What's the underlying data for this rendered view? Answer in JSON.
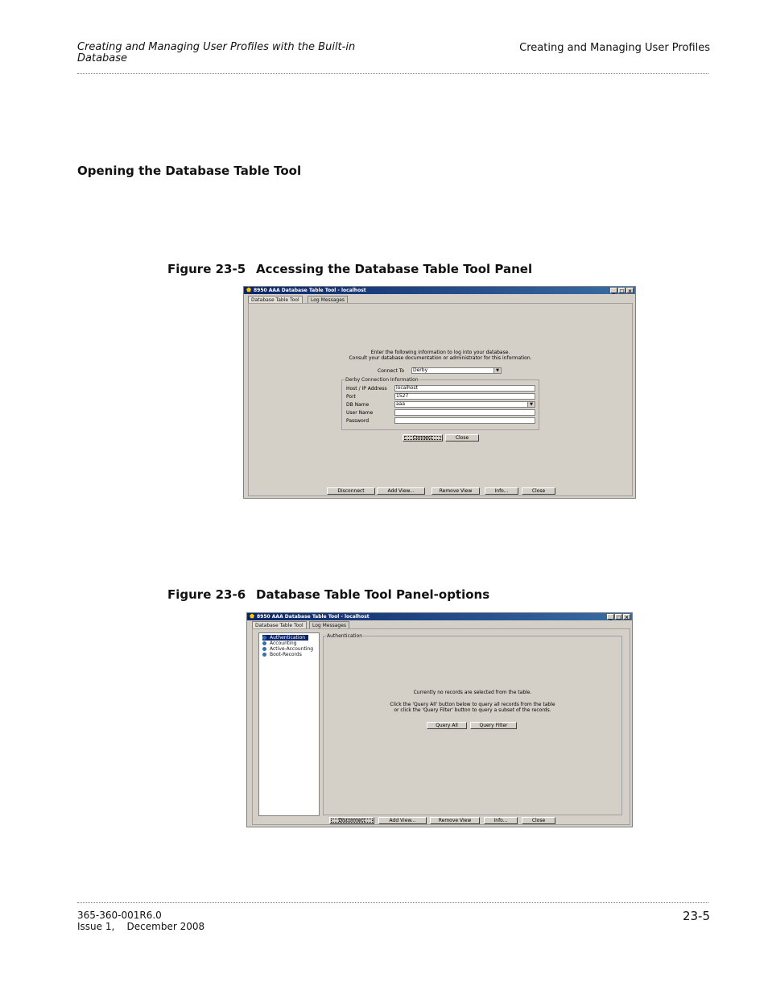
{
  "header": {
    "left": "Creating and Managing User Profiles with the Built-in Database",
    "right": "Creating and Managing User Profiles"
  },
  "section_title": "Opening the Database Table Tool",
  "figure1": {
    "number": "Figure 23-5",
    "caption": "Accessing the Database Table Tool Panel",
    "window_title": "8950 AAA Database Table Tool - localhost",
    "tabs": [
      "Database Table Tool",
      "Log Messages"
    ],
    "intro_line1": "Enter the following information to log into your database.",
    "intro_line2": "Consult your database documentation or administrator for this information.",
    "connect_to_label": "Connect To",
    "connect_to_value": "Derby",
    "group_title": "Derby Connection Information",
    "fields": [
      {
        "label": "Host / IP Address",
        "value": "localhost"
      },
      {
        "label": "Port",
        "value": "1527"
      },
      {
        "label": "DB Name",
        "value": "aaa"
      },
      {
        "label": "User Name",
        "value": ""
      },
      {
        "label": "Password",
        "value": ""
      }
    ],
    "connect_button": "Connect",
    "close_button": "Close",
    "bottom_buttons": [
      "Disconnect",
      "Add View...",
      "Remove View",
      "Info...",
      "Close"
    ]
  },
  "figure2": {
    "number": "Figure 23-6",
    "caption": "Database Table Tool Panel-options",
    "window_title": "8950 AAA Database Table Tool - localhost",
    "tabs": [
      "Database Table Tool",
      "Log Messages"
    ],
    "tree": [
      "Authentication",
      "Accounting",
      "Active-Accounting",
      "Boot-Records"
    ],
    "panel_title": "Authentication",
    "msg1": "Currently no records are selected from the table.",
    "msg2": "Click the 'Query All' button below to query all records from the table",
    "msg3": "or click the 'Query Filter' button to query a subset of the records.",
    "query_all": "Query All",
    "query_filter": "Query Filter",
    "bottom_buttons": [
      "Disconnect",
      "Add View...",
      "Remove View",
      "Info...",
      "Close"
    ]
  },
  "window_controls": {
    "minimize": "_",
    "maximize": "□",
    "close": "×"
  },
  "footer": {
    "doc_number": "365-360-001R6.0",
    "issue": "Issue 1,    December 2008",
    "page": "23-5"
  }
}
